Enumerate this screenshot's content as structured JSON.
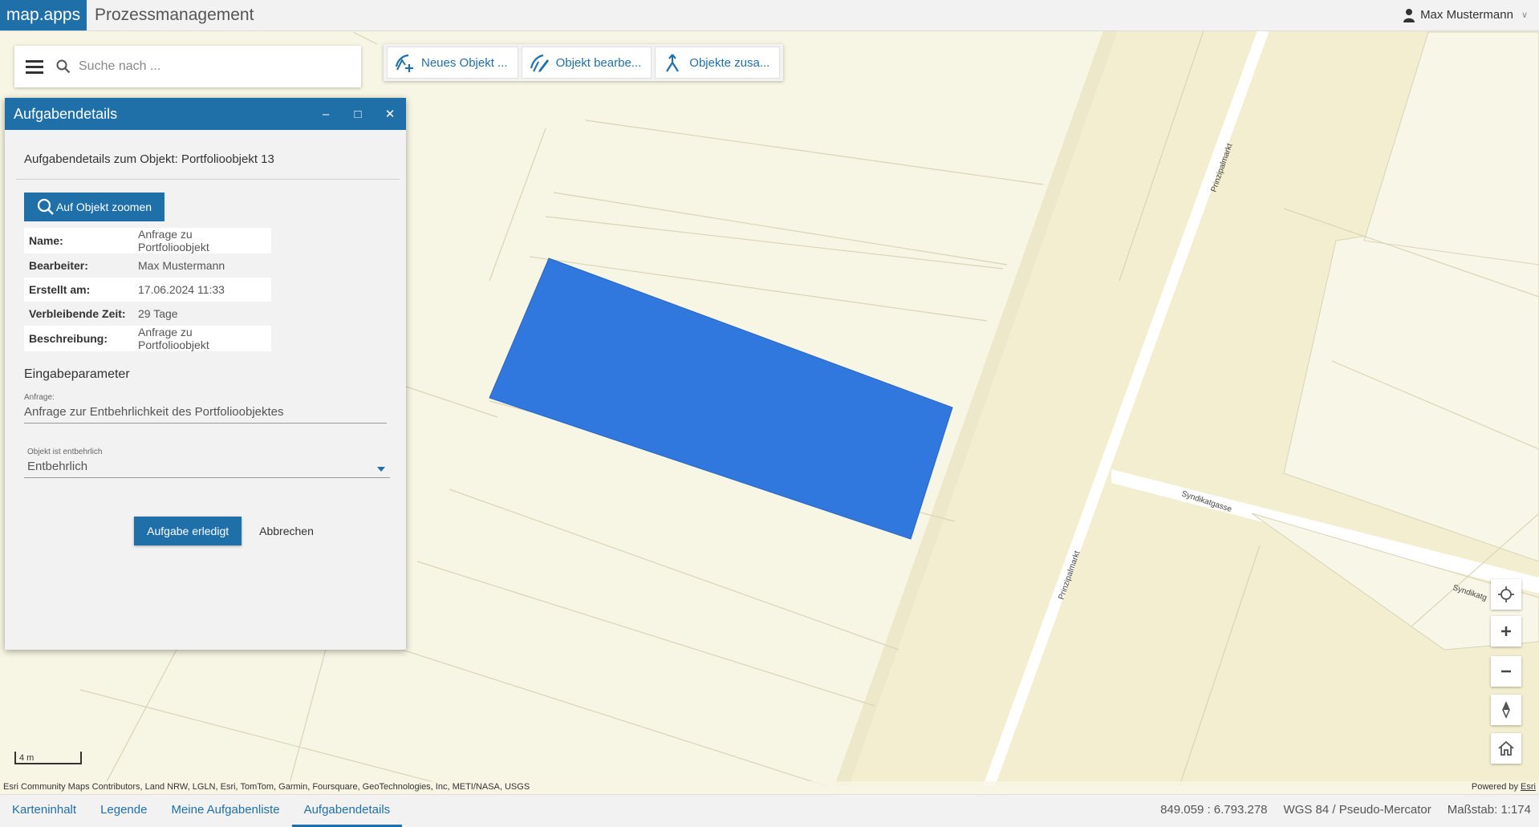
{
  "header": {
    "logo": "map.apps",
    "title": "Prozessmanagement",
    "user": "Max Mustermann"
  },
  "search": {
    "placeholder": "Suche nach ..."
  },
  "toolbar": {
    "new_object": "Neues Objekt ...",
    "edit_object": "Objekt bearbe...",
    "merge_objects": "Objekte zusa..."
  },
  "dialog": {
    "title": "Aufgabendetails",
    "object_heading": "Aufgabendetails zum Objekt: Portfolioobjekt 13",
    "zoom_button": "Auf Objekt zoomen",
    "properties": [
      {
        "key": "Name:",
        "value": "Anfrage zu Portfolioobjekt"
      },
      {
        "key": "Bearbeiter:",
        "value": "Max Mustermann"
      },
      {
        "key": "Erstellt am:",
        "value": "17.06.2024 11:33"
      },
      {
        "key": "Verbleibende Zeit:",
        "value": "29 Tage"
      },
      {
        "key": "Beschreibung:",
        "value": "Anfrage zu Portfolioobjekt"
      }
    ],
    "section_title": "Eingabeparameter",
    "request_label": "Anfrage:",
    "request_value": "Anfrage zur Entbehrlichkeit des Portfolioobjektes",
    "select_label": "Objekt ist entbehrlich",
    "select_value": "Entbehrlich",
    "done_button": "Aufgabe erledigt",
    "cancel_button": "Abbrechen"
  },
  "map": {
    "street_labels": [
      "Prinzipalmarkt",
      "Prinzipalmarkt",
      "Syndikatgasse",
      "Syndikatg"
    ],
    "scale_label": "4 m",
    "attribution": "Esri Community Maps Contributors, Land NRW, LGLN, Esri, TomTom, Garmin, Foursquare, GeoTechnologies, Inc, METI/NASA, USGS",
    "powered_by": "Powered by",
    "powered_by_link": "Esri",
    "highlight_color": "#3077de",
    "accent_color": "#1f6fa8"
  },
  "bottombar": {
    "tabs": [
      "Karteninhalt",
      "Legende",
      "Meine Aufgabenliste",
      "Aufgabendetails"
    ],
    "active_tab": 3,
    "coordinates": "849.059 : 6.793.278",
    "projection": "WGS 84 / Pseudo-Mercator",
    "scale": "Maßstab: 1:174"
  }
}
